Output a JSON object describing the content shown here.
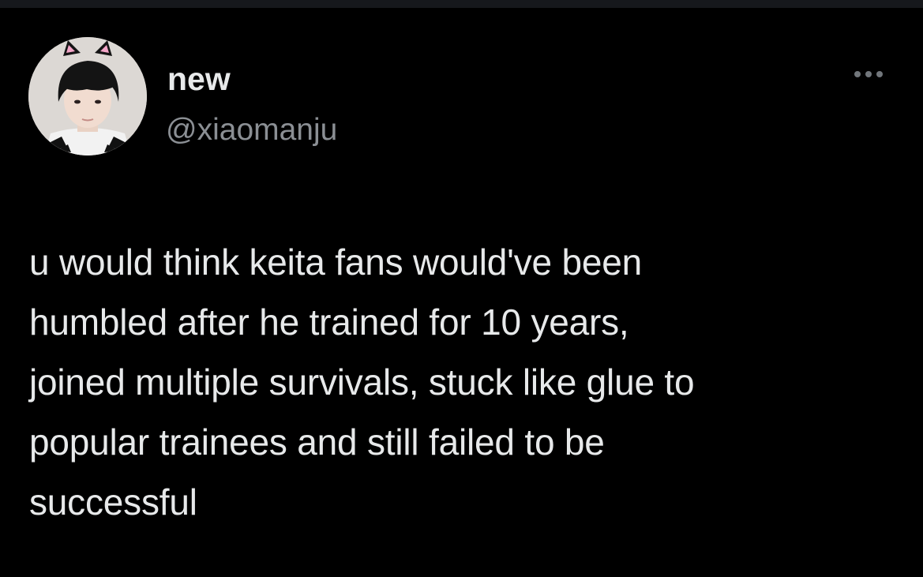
{
  "tweet": {
    "author": {
      "display_name": "new",
      "handle": "@xiaomanju"
    },
    "text_lines": [
      "u would think keita fans would've been",
      "humbled after he trained for 10 years,",
      "joined multiple survivals, stuck like glue to",
      "popular trainees and still failed to be",
      "successful"
    ],
    "more_icon": "more-horizontal-icon"
  },
  "colors": {
    "background": "#000000",
    "primary_text": "#e7e9ea",
    "secondary_text": "#8b8f94"
  }
}
